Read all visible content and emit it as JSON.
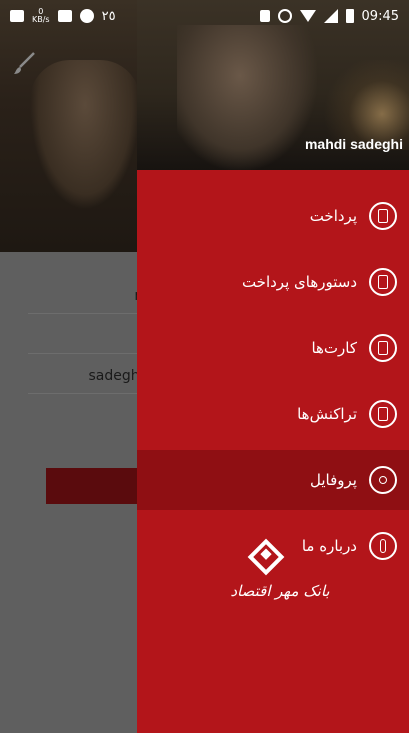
{
  "status_bar": {
    "left_text": "٢٥",
    "kb_label": "KB/s",
    "kb_value": "0",
    "time": "09:45"
  },
  "background_form": {
    "fields": [
      "m",
      "ـ",
      "sadeghi,"
    ]
  },
  "drawer": {
    "user_name": "mahdi sadeghi",
    "menu": [
      {
        "label": "پرداخت",
        "icon": "payment-icon",
        "active": false
      },
      {
        "label": "دستورهای پرداخت",
        "icon": "payment-orders-icon",
        "active": false
      },
      {
        "label": "کارت‌ها",
        "icon": "cards-icon",
        "active": false
      },
      {
        "label": "تراکنش‌ها",
        "icon": "transactions-icon",
        "active": false
      },
      {
        "label": "پروفایل",
        "icon": "profile-icon",
        "active": true
      },
      {
        "label": "درباره ما",
        "icon": "about-icon",
        "active": false
      }
    ],
    "logo_text": "بانک مهر اقتصاد"
  },
  "colors": {
    "drawer_bg": "#b3151a",
    "active_item_bg": "#8f0f13",
    "text": "#ffffff"
  }
}
